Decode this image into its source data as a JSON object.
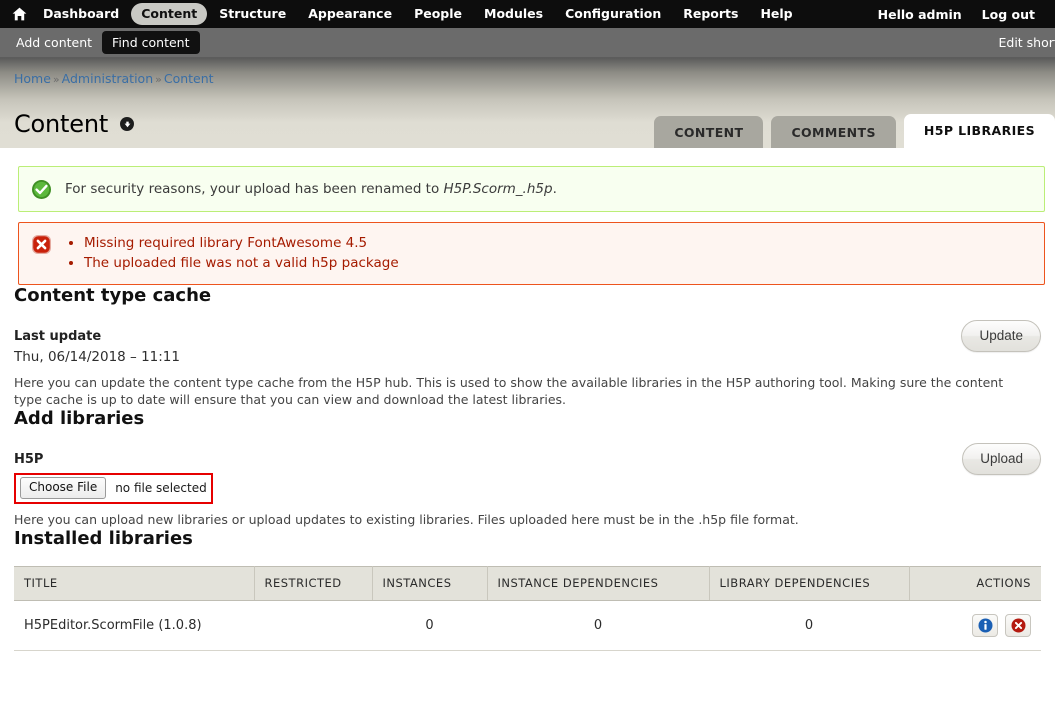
{
  "toolbar": {
    "home_icon": "home-icon",
    "items": [
      {
        "label": "Dashboard",
        "active": false
      },
      {
        "label": "Content",
        "active": true
      },
      {
        "label": "Structure",
        "active": false
      },
      {
        "label": "Appearance",
        "active": false
      },
      {
        "label": "People",
        "active": false
      },
      {
        "label": "Modules",
        "active": false
      },
      {
        "label": "Configuration",
        "active": false
      },
      {
        "label": "Reports",
        "active": false
      },
      {
        "label": "Help",
        "active": false
      }
    ],
    "greeting": "Hello admin",
    "logout": "Log out"
  },
  "shortcutbar": {
    "items": [
      {
        "label": "Add content",
        "active": false
      },
      {
        "label": "Find content",
        "active": true
      }
    ],
    "edit_shortcuts": "Edit shortcuts"
  },
  "breadcrumb": {
    "items": [
      "Home",
      "Administration",
      "Content"
    ],
    "separator": "»"
  },
  "page": {
    "title": "Content",
    "shortcut_toggle_icon": "add-shortcut-icon"
  },
  "tabs": [
    {
      "label": "CONTENT",
      "active": false
    },
    {
      "label": "COMMENTS",
      "active": false
    },
    {
      "label": "H5P LIBRARIES",
      "active": true
    }
  ],
  "messages": {
    "status": {
      "icon": "success-check-icon",
      "text_before": "For security reasons, your upload has been renamed to ",
      "text_em": "H5P.Scorm_.h5p",
      "text_after": "."
    },
    "error": {
      "icon": "error-x-icon",
      "items": [
        "Missing required library FontAwesome 4.5",
        "The uploaded file was not a valid h5p package"
      ]
    }
  },
  "content_type_cache": {
    "heading": "Content type cache",
    "label": "Last update",
    "value": "Thu, 06/14/2018 – 11:11",
    "description": "Here you can update the content type cache from the H5P hub. This is used to show the available libraries in the H5P authoring tool. Making sure the content type cache is up to date will ensure that you can view and download the latest libraries.",
    "button": "Update"
  },
  "add_libraries": {
    "heading": "Add libraries",
    "label": "H5P",
    "file_button": "Choose File",
    "file_name": "no file selected",
    "description": "Here you can upload new libraries or upload updates to existing libraries. Files uploaded here must be in the .h5p file format.",
    "button": "Upload"
  },
  "installed_libraries": {
    "heading": "Installed libraries",
    "columns": [
      "TITLE",
      "RESTRICTED",
      "INSTANCES",
      "INSTANCE DEPENDENCIES",
      "LIBRARY DEPENDENCIES",
      "ACTIONS"
    ],
    "rows": [
      {
        "title": "H5PEditor.ScormFile (1.0.8)",
        "restricted": "",
        "instances": "0",
        "instance_dependencies": "0",
        "library_dependencies": "0",
        "actions": [
          "details-info-icon",
          "delete-x-icon"
        ]
      }
    ]
  },
  "colors": {
    "toolbar_bg": "#0d0d0d",
    "shortcutbar_bg": "#6b6b6b",
    "header_beige": "#e0ded4",
    "tab_inactive": "#a8a79f",
    "link_blue": "#3a6ea5",
    "status_green": "#4ea32a",
    "error_red": "#a51b00",
    "error_border": "#ed541d",
    "file_error_border": "#e60000",
    "table_header_bg": "#e3e2da",
    "info_blue": "#1a5fb4"
  }
}
